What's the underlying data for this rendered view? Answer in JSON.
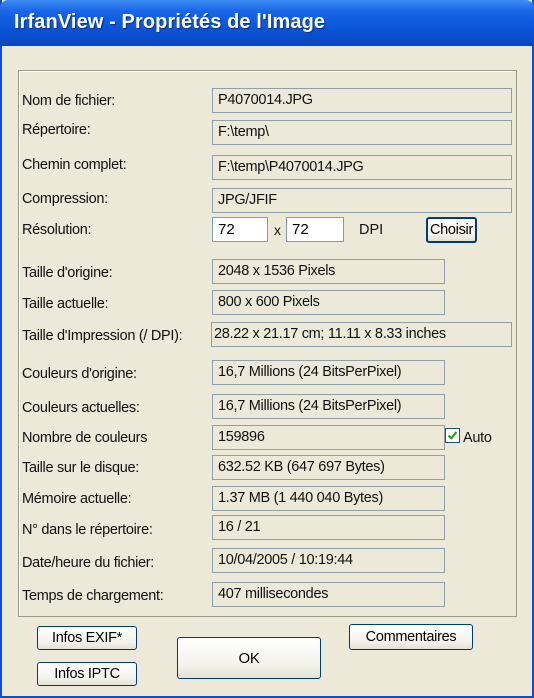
{
  "window": {
    "title": "IrfanView - Propriétés de l'Image"
  },
  "fields": [
    {
      "label": "Nom de fichier:",
      "value": "P4070014.JPG"
    },
    {
      "label": "Répertoire:",
      "value": "F:\\temp\\"
    },
    {
      "label": "Chemin complet:",
      "value": "F:\\temp\\P4070014.JPG"
    },
    {
      "label": "Compression:",
      "value": "JPG/JFIF"
    }
  ],
  "resolution": {
    "label": "Résolution:",
    "x": "72",
    "sep": "x",
    "y": "72",
    "unit": "DPI",
    "button": "Choisir"
  },
  "fields2": [
    {
      "label": "Taille d'origine:",
      "value": "2048 x 1536  Pixels"
    },
    {
      "label": "Taille actuelle:",
      "value": "800 x 600  Pixels"
    },
    {
      "label": "Taille d'Impression (/ DPI):",
      "value": "28.22 x 21.17 cm; 11.11 x 8.33 inches"
    },
    {
      "label": "Couleurs d'origine:",
      "value": "16,7 Millions   (24 BitsPerPixel)"
    },
    {
      "label": "Couleurs actuelles:",
      "value": "16,7 Millions   (24 BitsPerPixel)"
    }
  ],
  "colors_count": {
    "label": "Nombre de couleurs",
    "value": "159896",
    "auto_label": "Auto",
    "auto_checked": true
  },
  "fields3": [
    {
      "label": "Taille sur le disque:",
      "value": "632.52 KB (647 697 Bytes)"
    },
    {
      "label": "Mémoire actuelle:",
      "value": "1.37  MB (1 440 040 Bytes)"
    },
    {
      "label": "N° dans le répertoire:",
      "value": "16  /  21"
    },
    {
      "label": "Date/heure du fichier:",
      "value": "10/04/2005 / 10:19:44"
    },
    {
      "label": "Temps de chargement:",
      "value": "407 millisecondes"
    }
  ],
  "buttons": {
    "exif": "Infos EXIF*",
    "iptc": "Infos IPTC",
    "ok": "OK",
    "comments": "Commentaires"
  }
}
